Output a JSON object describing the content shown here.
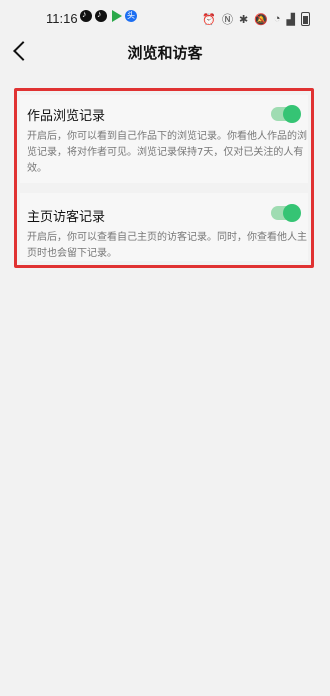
{
  "status_bar": {
    "time": "11:16",
    "icons": [
      "tiktok-icon",
      "tiktok-icon",
      "play-store-icon",
      "toutiao-icon",
      "alarm-icon",
      "nfc-icon",
      "bluetooth-icon",
      "mute-icon",
      "wifi-icon",
      "signal-icon",
      "battery-icon"
    ]
  },
  "header": {
    "title": "浏览和访客"
  },
  "settings": {
    "works_views": {
      "title": "作品浏览记录",
      "description": "开启后，你可以看到自己作品下的浏览记录。你看他人作品的浏览记录，将对作者可见。浏览记录保持7天，仅对已关注的人有效。",
      "enabled": true
    },
    "profile_visitors": {
      "title": "主页访客记录",
      "description": "开启后，你可以查看自己主页的访客记录。同时，你查看他人主页时也会留下记录。",
      "enabled": true
    }
  },
  "colors": {
    "toggle_on": "#35c474",
    "toggle_track": "#9fdcb2",
    "highlight_border": "#e03232"
  }
}
